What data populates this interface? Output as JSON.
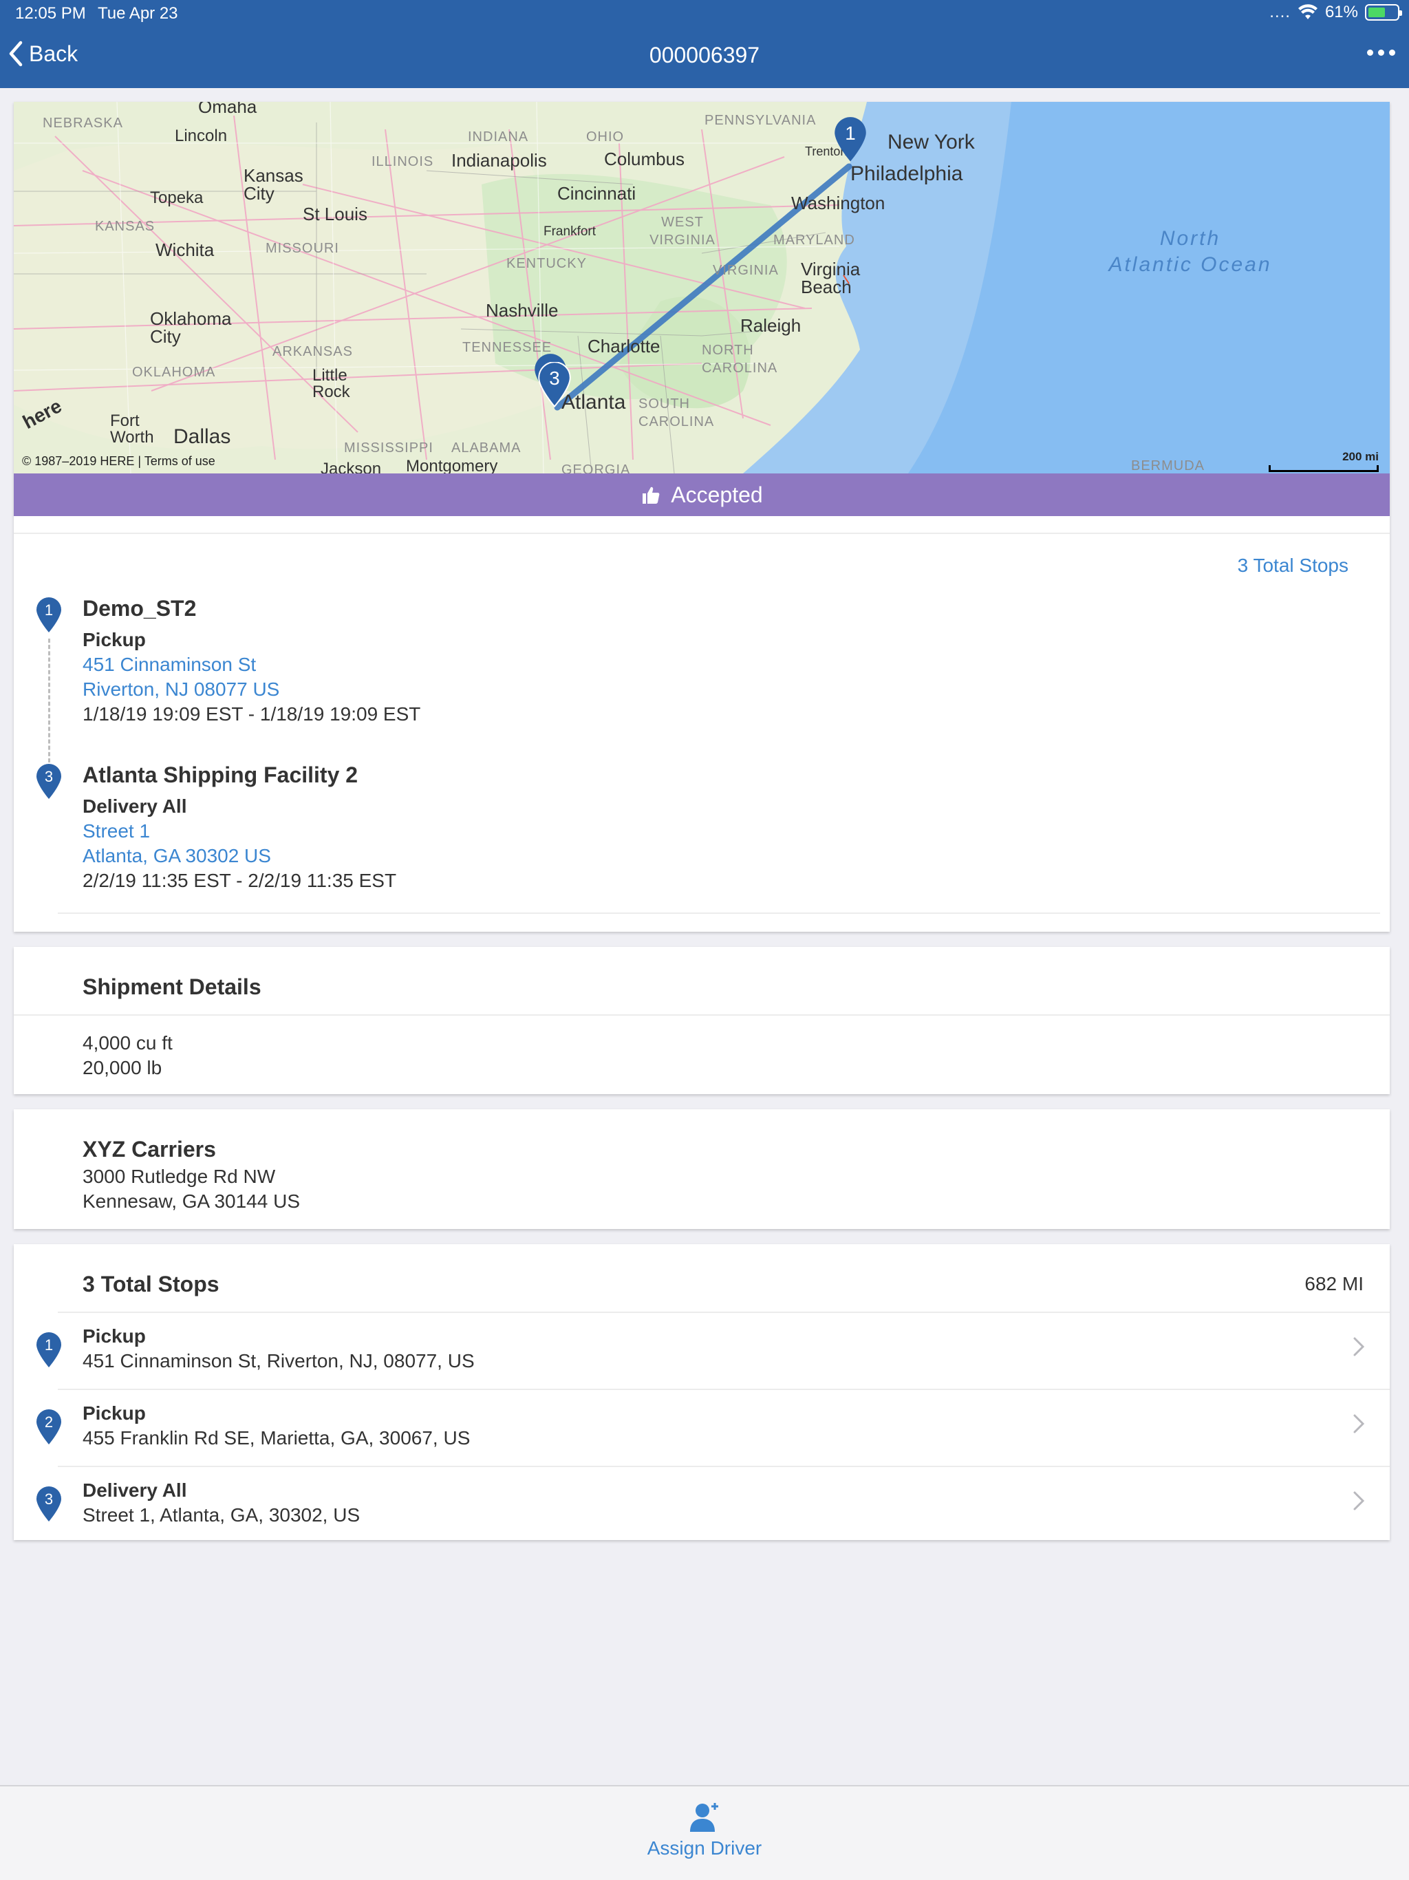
{
  "status_bar": {
    "time": "12:05 PM",
    "date": "Tue Apr 23",
    "signal": "....",
    "battery": "61%",
    "battery_level_percent": 61,
    "icons": [
      "wifi-icon",
      "battery-charging-icon"
    ]
  },
  "nav": {
    "back_label": "Back",
    "title": "000006397",
    "icons": [
      "chevron-left-icon",
      "more-dots-icon"
    ]
  },
  "map": {
    "copyright": "© 1987–2019 HERE | Terms of use",
    "logo": "here",
    "scale_label": "200 mi",
    "ocean_line1": "North",
    "ocean_line2": "Atlantic Ocean",
    "cities": {
      "omaha": "Omaha",
      "lincoln": "Lincoln",
      "kansas_city": "Kansas City",
      "topeka": "Topeka",
      "wichita": "Wichita",
      "oklahoma_city": "Oklahoma City",
      "st_louis": "St Louis",
      "indianapolis": "Indianapolis",
      "columbus": "Columbus",
      "cincinnati": "Cincinnati",
      "frankfort": "Frankfort",
      "nashville": "Nashville",
      "little_rock": "Little Rock",
      "dallas": "Dallas",
      "fort_worth": "Fort Worth",
      "jackson": "Jackson",
      "montgomery": "Montgomery",
      "atlanta": "Atlanta",
      "charlotte": "Charlotte",
      "raleigh": "Raleigh",
      "virginia_beach": "Virginia Beach",
      "washington": "Washington",
      "philadelphia": "Philadelphia",
      "new_york": "New York",
      "trenton": "Trenton",
      "bermuda": "BERMUDA"
    },
    "states": {
      "nebraska": "NEBRASKA",
      "kansas": "KANSAS",
      "missouri": "MISSOURI",
      "oklahoma": "OKLAHOMA",
      "arkansas": "ARKANSAS",
      "illinois": "ILLINOIS",
      "indiana": "INDIANA",
      "ohio": "OHIO",
      "kentucky": "KENTUCKY",
      "tennessee": "TENNESSEE",
      "mississippi": "MISSISSIPPI",
      "alabama": "ALABAMA",
      "georgia": "GEORGIA",
      "south_carolina": "SOUTH CAROLINA",
      "north_carolina": "NORTH CAROLINA",
      "virginia": "VIRGINIA",
      "west_virginia": "WEST VIRGINIA",
      "maryland": "MARYLAND",
      "pennsylvania": "PENNSYLVANIA"
    },
    "pins": [
      {
        "label": "1"
      },
      {
        "label": "3"
      }
    ]
  },
  "status_banner": {
    "label": "Accepted",
    "icon": "thumbs-up-icon",
    "color": "#8e78c1"
  },
  "route": {
    "total_stops_link": "3 Total Stops",
    "stops": [
      {
        "number": "1",
        "name": "Demo_ST2",
        "type": "Pickup",
        "address_line1": "451 Cinnaminson St",
        "address_line2": "Riverton, NJ 08077 US",
        "window": "1/18/19 19:09 EST - 1/18/19 19:09 EST"
      },
      {
        "number": "3",
        "name": "Atlanta Shipping Facility 2",
        "type": "Delivery All",
        "address_line1": "Street 1",
        "address_line2": "Atlanta, GA 30302 US",
        "window": "2/2/19 11:35 EST - 2/2/19 11:35 EST"
      }
    ]
  },
  "shipment": {
    "title": "Shipment Details",
    "volume": "4,000 cu ft",
    "weight": "20,000 lb"
  },
  "carrier": {
    "name": "XYZ Carriers",
    "address_line1": "3000 Rutledge Rd NW",
    "address_line2": "Kennesaw, GA 30144 US"
  },
  "stops_list": {
    "title": "3 Total Stops",
    "distance": "682 MI",
    "items": [
      {
        "number": "1",
        "type": "Pickup",
        "address": "451 Cinnaminson St, Riverton, NJ, 08077, US"
      },
      {
        "number": "2",
        "type": "Pickup",
        "address": "455 Franklin Rd SE, Marietta, GA, 30067, US"
      },
      {
        "number": "3",
        "type": "Delivery All",
        "address": "Street 1, Atlanta, GA, 30302, US"
      }
    ]
  },
  "bottom_action": {
    "label": "Assign Driver",
    "icon": "assign-driver-icon"
  },
  "colors": {
    "primary": "#2b62a8",
    "link": "#3b86d1",
    "accepted": "#8e78c1",
    "background": "#efeff4",
    "pin": "#2b62a8"
  }
}
